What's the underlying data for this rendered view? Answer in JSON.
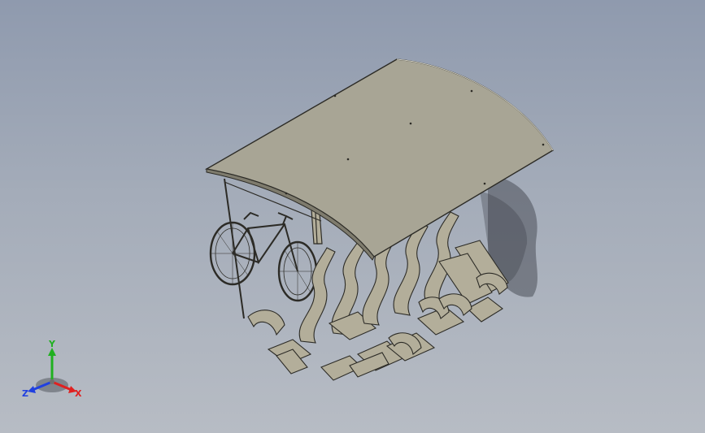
{
  "viewport": {
    "background_top": "#8f9aae",
    "background_bottom": "#b7bcc4"
  },
  "model": {
    "part_color": "#b3ae9a",
    "roof_color": "#a8a595",
    "edge_color": "#2c2b26",
    "shadow_color": "#4a4f58"
  },
  "triad": {
    "x_label": "X",
    "y_label": "Y",
    "z_label": "Z",
    "x_color": "#e02020",
    "y_color": "#20b020",
    "z_color": "#2040e0"
  }
}
